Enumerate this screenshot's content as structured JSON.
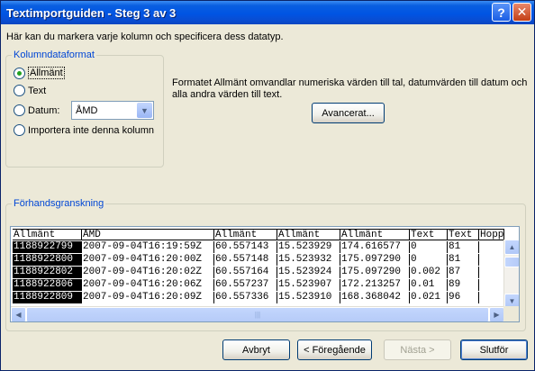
{
  "window": {
    "title": "Textimportguiden - Steg 3 av 3",
    "help_glyph": "?",
    "close_glyph": "✕"
  },
  "intro": "Här kan du markera varje kolumn och specificera dess datatyp.",
  "column_format": {
    "legend": "Kolumndataformat",
    "options": [
      {
        "label": "Allmänt",
        "selected": true
      },
      {
        "label": "Text",
        "selected": false
      },
      {
        "label": "Datum:",
        "selected": false
      },
      {
        "label": "Importera inte denna kolumn",
        "selected": false
      }
    ],
    "date_format_value": "ÅMD"
  },
  "description": "Formatet Allmänt omvandlar numeriska värden till tal, datumvärden till datum och alla andra värden till text.",
  "advanced_button": "Avancerat...",
  "preview": {
    "legend": "Förhandsgranskning",
    "headers": [
      "Allmänt",
      "ÅMD",
      "Allmänt",
      "Allmänt",
      "Allmänt",
      "Text",
      "Text",
      "Hoppa"
    ],
    "rows": [
      [
        "1188922799",
        "2007-09-04T16:19:59Z",
        "60.557143",
        "15.523929",
        "174.616577",
        "0",
        "81",
        ""
      ],
      [
        "1188922800",
        "2007-09-04T16:20:00Z",
        "60.557148",
        "15.523932",
        "175.097290",
        "0",
        "81",
        ""
      ],
      [
        "1188922802",
        "2007-09-04T16:20:02Z",
        "60.557164",
        "15.523924",
        "175.097290",
        "0.002",
        "87",
        ""
      ],
      [
        "1188922806",
        "2007-09-04T16:20:06Z",
        "60.557237",
        "15.523907",
        "172.213257",
        "0.01",
        "89",
        ""
      ],
      [
        "1188922809",
        "2007-09-04T16:20:09Z",
        "60.557336",
        "15.523910",
        "168.368042",
        "0.021",
        "96",
        ""
      ]
    ]
  },
  "buttons": {
    "cancel": "Avbryt",
    "back": "< Föregående",
    "next": "Nästa >",
    "finish": "Slutför"
  }
}
